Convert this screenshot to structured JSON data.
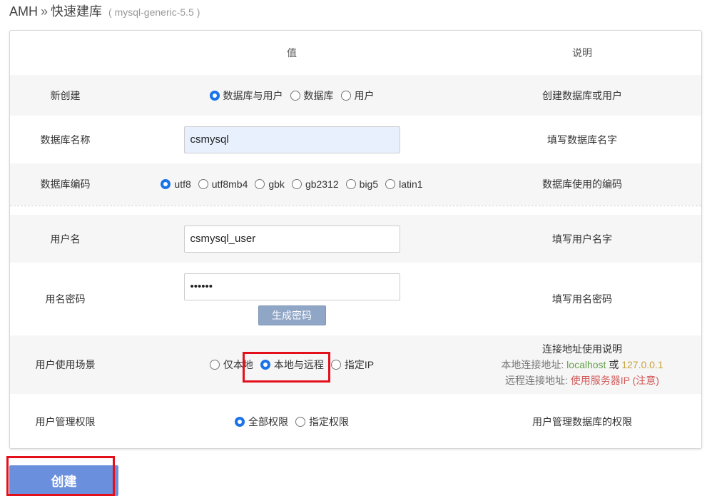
{
  "breadcrumb": {
    "app": "AMH",
    "separator": "»",
    "page": "快速建库",
    "note": "( mysql-generic-5.5 )"
  },
  "table_header": {
    "value": "值",
    "description": "说明"
  },
  "rows": {
    "create_new": {
      "label": "新创建",
      "options": [
        "数据库与用户",
        "数据库",
        "用户"
      ],
      "selected": "数据库与用户",
      "desc": "创建数据库或用户"
    },
    "db_name": {
      "label": "数据库名称",
      "value": "csmysql",
      "desc": "填写数据库名字"
    },
    "db_charset": {
      "label": "数据库编码",
      "options": [
        "utf8",
        "utf8mb4",
        "gbk",
        "gb2312",
        "big5",
        "latin1"
      ],
      "selected": "utf8",
      "desc": "数据库使用的编码"
    },
    "username": {
      "label": "用户名",
      "value": "csmysql_user",
      "desc": "填写用户名字"
    },
    "password": {
      "label": "用名密码",
      "value": "••••••",
      "generate_label": "生成密码",
      "desc": "填写用名密码"
    },
    "usage_scene": {
      "label": "用户使用场景",
      "options": [
        "仅本地",
        "本地与远程",
        "指定IP"
      ],
      "selected": "本地与远程",
      "desc_title": "连接地址使用说明",
      "local_label": "本地连接地址:",
      "local_host": "localhost",
      "local_or": "或",
      "local_ip": "127.0.0.1",
      "remote_label": "远程连接地址:",
      "remote_value": "使用服务器IP (注意)"
    },
    "permissions": {
      "label": "用户管理权限",
      "options": [
        "全部权限",
        "指定权限"
      ],
      "selected": "全部权限",
      "desc": "用户管理数据库的权限"
    }
  },
  "create_button": "创建",
  "colors": {
    "highlight": "#e3101b",
    "create_button": "#6a8fdc",
    "radio_checked": "#1a73e8"
  }
}
